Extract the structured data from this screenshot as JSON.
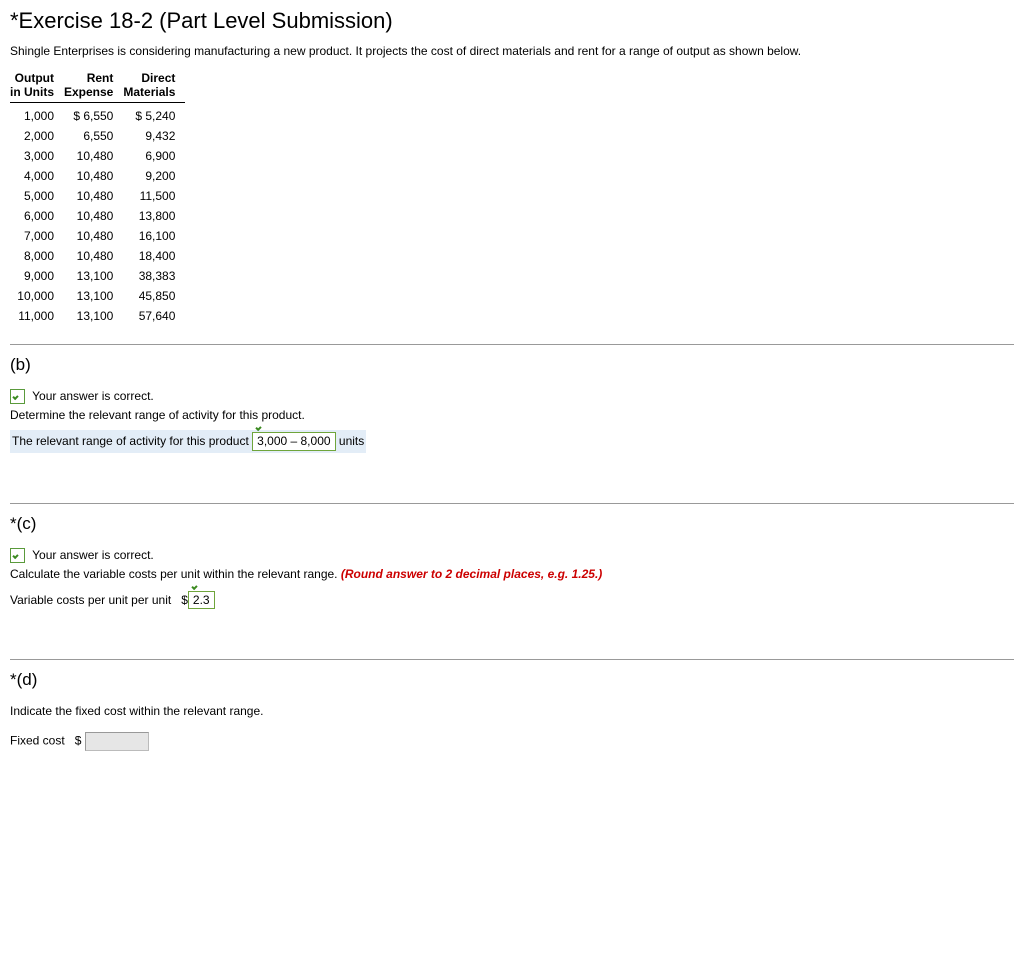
{
  "title": "*Exercise 18-2 (Part Level Submission)",
  "intro": "Shingle Enterprises is considering manufacturing a new product. It projects the cost of direct materials and rent for a range of output as shown below.",
  "table": {
    "headers": {
      "c0a": "Output",
      "c0b": "in Units",
      "c1a": "Rent",
      "c1b": "Expense",
      "c2a": "Direct",
      "c2b": "Materials"
    },
    "rows": [
      {
        "out": "1,000",
        "rent": "$ 6,550",
        "mat": "$ 5,240"
      },
      {
        "out": "2,000",
        "rent": "6,550",
        "mat": "9,432"
      },
      {
        "out": "3,000",
        "rent": "10,480",
        "mat": "6,900"
      },
      {
        "out": "4,000",
        "rent": "10,480",
        "mat": "9,200"
      },
      {
        "out": "5,000",
        "rent": "10,480",
        "mat": "11,500"
      },
      {
        "out": "6,000",
        "rent": "10,480",
        "mat": "13,800"
      },
      {
        "out": "7,000",
        "rent": "10,480",
        "mat": "16,100"
      },
      {
        "out": "8,000",
        "rent": "10,480",
        "mat": "18,400"
      },
      {
        "out": "9,000",
        "rent": "13,100",
        "mat": "38,383"
      },
      {
        "out": "10,000",
        "rent": "13,100",
        "mat": "45,850"
      },
      {
        "out": "11,000",
        "rent": "13,100",
        "mat": "57,640"
      }
    ]
  },
  "b": {
    "label": "(b)",
    "correct": "Your answer is correct.",
    "instruction": "Determine the relevant range of activity for this product.",
    "prefix": "The relevant range of activity for this product",
    "answer": "3,000 – 8,000",
    "suffix": "units"
  },
  "c": {
    "label": "*(c)",
    "correct": "Your answer is correct.",
    "instruction_plain": "Calculate the variable costs per unit within the relevant range. ",
    "instruction_red": "(Round answer to 2 decimal places, e.g. 1.25.)",
    "prefix": "Variable costs per unit per unit",
    "currency": "$",
    "answer": "2.3"
  },
  "d": {
    "label": "*(d)",
    "instruction": "Indicate the fixed cost within the relevant range.",
    "prefix": "Fixed cost",
    "currency": "$"
  }
}
